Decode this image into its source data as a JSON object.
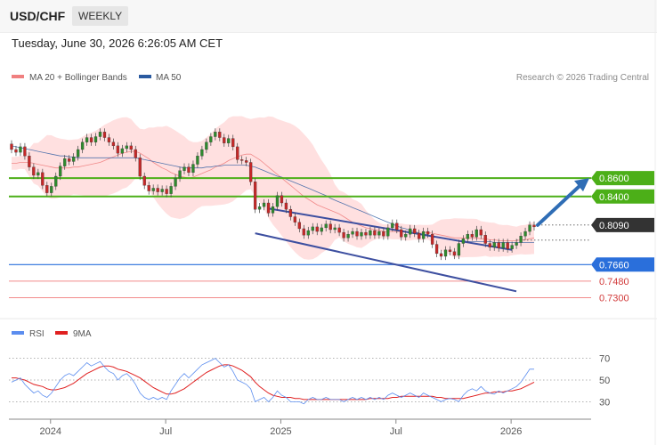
{
  "header": {
    "symbol": "USD/CHF",
    "period": "WEEKLY",
    "timestamp": "Tuesday, June 30, 2026 6:26:05 AM CET"
  },
  "legend": {
    "items": [
      {
        "label": "MA 20 + Bollinger Bands",
        "color": "#f08080"
      },
      {
        "label": "MA 50",
        "color": "#2a5aa0"
      }
    ],
    "credit": "Research © 2026 Trading Central"
  },
  "rsi_legend": {
    "items": [
      {
        "label": "RSI",
        "color": "#5b8def"
      },
      {
        "label": "9MA",
        "color": "#e02020"
      }
    ]
  },
  "colors": {
    "up_candle": "#2e8b2e",
    "down_candle": "#c62828",
    "bollinger_fill": "#ffd6d6",
    "resistance": "#4caf18",
    "support": "#2a6fdb",
    "lower_support": "#f28b8b",
    "arrow": "#2f6db5",
    "current_tag": "#333333",
    "channel": "#3d4fa0"
  },
  "chart_data": [
    {
      "type": "candlestick",
      "title": "",
      "ylim": [
        0.717,
        0.949
      ],
      "x_tick_labels": [
        "2024",
        "Jul",
        "2025",
        "Jul",
        "2026"
      ],
      "candles": [
        {
          "o": 0.897,
          "c": 0.891
        },
        {
          "o": 0.891,
          "c": 0.888
        },
        {
          "o": 0.888,
          "c": 0.894
        },
        {
          "o": 0.894,
          "c": 0.884
        },
        {
          "o": 0.884,
          "c": 0.872
        },
        {
          "o": 0.872,
          "c": 0.863
        },
        {
          "o": 0.863,
          "c": 0.866
        },
        {
          "o": 0.866,
          "c": 0.852
        },
        {
          "o": 0.852,
          "c": 0.844
        },
        {
          "o": 0.844,
          "c": 0.851
        },
        {
          "o": 0.851,
          "c": 0.862
        },
        {
          "o": 0.862,
          "c": 0.873
        },
        {
          "o": 0.873,
          "c": 0.881
        },
        {
          "o": 0.881,
          "c": 0.878
        },
        {
          "o": 0.878,
          "c": 0.883
        },
        {
          "o": 0.883,
          "c": 0.891
        },
        {
          "o": 0.891,
          "c": 0.899
        },
        {
          "o": 0.899,
          "c": 0.904
        },
        {
          "o": 0.904,
          "c": 0.899
        },
        {
          "o": 0.899,
          "c": 0.905
        },
        {
          "o": 0.905,
          "c": 0.91
        },
        {
          "o": 0.91,
          "c": 0.904
        },
        {
          "o": 0.904,
          "c": 0.899
        },
        {
          "o": 0.899,
          "c": 0.895
        },
        {
          "o": 0.895,
          "c": 0.887
        },
        {
          "o": 0.887,
          "c": 0.892
        },
        {
          "o": 0.892,
          "c": 0.895
        },
        {
          "o": 0.895,
          "c": 0.891
        },
        {
          "o": 0.891,
          "c": 0.882
        },
        {
          "o": 0.882,
          "c": 0.862
        },
        {
          "o": 0.862,
          "c": 0.852
        },
        {
          "o": 0.852,
          "c": 0.846
        },
        {
          "o": 0.846,
          "c": 0.849
        },
        {
          "o": 0.849,
          "c": 0.845
        },
        {
          "o": 0.845,
          "c": 0.848
        },
        {
          "o": 0.848,
          "c": 0.843
        },
        {
          "o": 0.843,
          "c": 0.851
        },
        {
          "o": 0.851,
          "c": 0.86
        },
        {
          "o": 0.86,
          "c": 0.868
        },
        {
          "o": 0.868,
          "c": 0.872
        },
        {
          "o": 0.872,
          "c": 0.866
        },
        {
          "o": 0.866,
          "c": 0.875
        },
        {
          "o": 0.875,
          "c": 0.884
        },
        {
          "o": 0.884,
          "c": 0.891
        },
        {
          "o": 0.891,
          "c": 0.899
        },
        {
          "o": 0.899,
          "c": 0.905
        },
        {
          "o": 0.905,
          "c": 0.91
        },
        {
          "o": 0.91,
          "c": 0.904
        },
        {
          "o": 0.904,
          "c": 0.898
        },
        {
          "o": 0.898,
          "c": 0.903
        },
        {
          "o": 0.903,
          "c": 0.894
        },
        {
          "o": 0.894,
          "c": 0.88
        },
        {
          "o": 0.88,
          "c": 0.879
        },
        {
          "o": 0.879,
          "c": 0.877
        },
        {
          "o": 0.877,
          "c": 0.856
        },
        {
          "o": 0.856,
          "c": 0.826
        },
        {
          "o": 0.826,
          "c": 0.829
        },
        {
          "o": 0.829,
          "c": 0.833
        },
        {
          "o": 0.833,
          "c": 0.822
        },
        {
          "o": 0.822,
          "c": 0.829
        },
        {
          "o": 0.829,
          "c": 0.841
        },
        {
          "o": 0.841,
          "c": 0.833
        },
        {
          "o": 0.833,
          "c": 0.826
        },
        {
          "o": 0.826,
          "c": 0.818
        },
        {
          "o": 0.818,
          "c": 0.812
        },
        {
          "o": 0.812,
          "c": 0.805
        },
        {
          "o": 0.805,
          "c": 0.798
        },
        {
          "o": 0.798,
          "c": 0.803
        },
        {
          "o": 0.803,
          "c": 0.807
        },
        {
          "o": 0.807,
          "c": 0.802
        },
        {
          "o": 0.802,
          "c": 0.806
        },
        {
          "o": 0.806,
          "c": 0.81
        },
        {
          "o": 0.81,
          "c": 0.804
        },
        {
          "o": 0.804,
          "c": 0.806
        },
        {
          "o": 0.806,
          "c": 0.801
        },
        {
          "o": 0.801,
          "c": 0.795
        },
        {
          "o": 0.795,
          "c": 0.799
        },
        {
          "o": 0.799,
          "c": 0.802
        },
        {
          "o": 0.802,
          "c": 0.797
        },
        {
          "o": 0.797,
          "c": 0.801
        },
        {
          "o": 0.801,
          "c": 0.798
        },
        {
          "o": 0.798,
          "c": 0.803
        },
        {
          "o": 0.803,
          "c": 0.798
        },
        {
          "o": 0.798,
          "c": 0.802
        },
        {
          "o": 0.802,
          "c": 0.797
        },
        {
          "o": 0.797,
          "c": 0.806
        },
        {
          "o": 0.806,
          "c": 0.811
        },
        {
          "o": 0.811,
          "c": 0.804
        },
        {
          "o": 0.804,
          "c": 0.796
        },
        {
          "o": 0.796,
          "c": 0.799
        },
        {
          "o": 0.799,
          "c": 0.805
        },
        {
          "o": 0.805,
          "c": 0.8
        },
        {
          "o": 0.8,
          "c": 0.794
        },
        {
          "o": 0.794,
          "c": 0.802
        },
        {
          "o": 0.802,
          "c": 0.799
        },
        {
          "o": 0.799,
          "c": 0.788
        },
        {
          "o": 0.788,
          "c": 0.778
        },
        {
          "o": 0.778,
          "c": 0.775
        },
        {
          "o": 0.775,
          "c": 0.782
        },
        {
          "o": 0.782,
          "c": 0.78
        },
        {
          "o": 0.78,
          "c": 0.776
        },
        {
          "o": 0.776,
          "c": 0.789
        },
        {
          "o": 0.789,
          "c": 0.794
        },
        {
          "o": 0.794,
          "c": 0.799
        },
        {
          "o": 0.799,
          "c": 0.796
        },
        {
          "o": 0.796,
          "c": 0.804
        },
        {
          "o": 0.804,
          "c": 0.798
        },
        {
          "o": 0.798,
          "c": 0.789
        },
        {
          "o": 0.789,
          "c": 0.785
        },
        {
          "o": 0.785,
          "c": 0.79
        },
        {
          "o": 0.79,
          "c": 0.784
        },
        {
          "o": 0.784,
          "c": 0.79
        },
        {
          "o": 0.79,
          "c": 0.783
        },
        {
          "o": 0.783,
          "c": 0.787
        },
        {
          "o": 0.787,
          "c": 0.79
        },
        {
          "o": 0.79,
          "c": 0.797
        },
        {
          "o": 0.797,
          "c": 0.802
        },
        {
          "o": 0.802,
          "c": 0.809
        },
        {
          "o": 0.809,
          "c": 0.807
        }
      ],
      "lines": [
        {
          "name": "MA 20 + Bollinger Bands",
          "color": "#f08080",
          "values": [
            0.876,
            0.876,
            0.877,
            0.877,
            0.877,
            0.876,
            0.875,
            0.874,
            0.873,
            0.872,
            0.871,
            0.871,
            0.871,
            0.871,
            0.872,
            0.872,
            0.873,
            0.874,
            0.875,
            0.876,
            0.877,
            0.879,
            0.881,
            0.883,
            0.885,
            0.887,
            0.888,
            0.889,
            0.889,
            0.887,
            0.884,
            0.881,
            0.877,
            0.874,
            0.871,
            0.869,
            0.866,
            0.864,
            0.862,
            0.861,
            0.86,
            0.861,
            0.863,
            0.865,
            0.867,
            0.869,
            0.872,
            0.874,
            0.876,
            0.879,
            0.881,
            0.883,
            0.885,
            0.886,
            0.886,
            0.883,
            0.88,
            0.876,
            0.872,
            0.868,
            0.864,
            0.86,
            0.856,
            0.852,
            0.848,
            0.844,
            0.84,
            0.837,
            0.834,
            0.831,
            0.829,
            0.827,
            0.825,
            0.823,
            0.821,
            0.818,
            0.815,
            0.812,
            0.81,
            0.808,
            0.806,
            0.805,
            0.804,
            0.803,
            0.802,
            0.802,
            0.802,
            0.802,
            0.802,
            0.801,
            0.801,
            0.801,
            0.801,
            0.801,
            0.801,
            0.8,
            0.799,
            0.798,
            0.797,
            0.796,
            0.795,
            0.795,
            0.795,
            0.795,
            0.795,
            0.795,
            0.794,
            0.794,
            0.793,
            0.793,
            0.792,
            0.792,
            0.792,
            0.792,
            0.792,
            0.793,
            0.793,
            0.794,
            0.795
          ]
        },
        {
          "name": "MA 50",
          "color": "#2a5aa0",
          "values": [
            0.895,
            0.894,
            0.893,
            0.892,
            0.891,
            0.89,
            0.889,
            0.888,
            0.887,
            0.886,
            0.885,
            0.884,
            0.884,
            0.883,
            0.883,
            0.882,
            0.882,
            0.882,
            0.882,
            0.882,
            0.882,
            0.882,
            0.882,
            0.882,
            0.882,
            0.882,
            0.882,
            0.882,
            0.882,
            0.881,
            0.88,
            0.879,
            0.878,
            0.877,
            0.876,
            0.875,
            0.874,
            0.873,
            0.872,
            0.871,
            0.871,
            0.871,
            0.871,
            0.871,
            0.872,
            0.872,
            0.873,
            0.873,
            0.874,
            0.874,
            0.874,
            0.874,
            0.874,
            0.874,
            0.873,
            0.872,
            0.87,
            0.868,
            0.866,
            0.864,
            0.862,
            0.861,
            0.859,
            0.857,
            0.855,
            0.853,
            0.851,
            0.849,
            0.847,
            0.845,
            0.843,
            0.841,
            0.838,
            0.836,
            0.834,
            0.832,
            0.83,
            0.828,
            0.826,
            0.824,
            0.822,
            0.82,
            0.818,
            0.816,
            0.814,
            0.812,
            0.81,
            0.808,
            0.806,
            0.805,
            0.803,
            0.802,
            0.8,
            0.799,
            0.798,
            0.797,
            0.796,
            0.795,
            0.794,
            0.793,
            0.793,
            0.792,
            0.792,
            0.791,
            0.791,
            0.791,
            0.791,
            0.791,
            0.791,
            0.79,
            0.79,
            0.79,
            0.79,
            0.79,
            0.79,
            0.79,
            0.79,
            0.79,
            0.79
          ]
        }
      ],
      "levels": [
        {
          "label": "0.8600",
          "value": 0.86,
          "role": "resistance"
        },
        {
          "label": "0.8400",
          "value": 0.84,
          "role": "resistance"
        },
        {
          "label": "0.8090",
          "value": 0.809,
          "role": "current"
        },
        {
          "label": "0.7660",
          "value": 0.766,
          "role": "support"
        },
        {
          "label": "0.7480",
          "value": 0.748,
          "role": "lower_support"
        },
        {
          "label": "0.7300",
          "value": 0.73,
          "role": "lower_support"
        }
      ]
    },
    {
      "type": "line",
      "title": "",
      "ylim": [
        18,
        82
      ],
      "y_ticks": [
        70,
        50,
        30
      ],
      "series": [
        {
          "name": "RSI",
          "color": "#5b8def",
          "values": [
            48,
            50,
            52,
            46,
            42,
            38,
            40,
            36,
            34,
            38,
            44,
            50,
            54,
            56,
            54,
            58,
            62,
            66,
            63,
            65,
            67,
            62,
            58,
            56,
            50,
            54,
            56,
            52,
            46,
            38,
            34,
            32,
            34,
            32,
            34,
            32,
            40,
            46,
            52,
            56,
            52,
            56,
            60,
            64,
            66,
            68,
            70,
            66,
            62,
            64,
            58,
            50,
            48,
            46,
            42,
            30,
            32,
            34,
            30,
            34,
            40,
            36,
            34,
            30,
            30,
            30,
            28,
            32,
            34,
            32,
            32,
            34,
            32,
            32,
            32,
            30,
            32,
            34,
            32,
            34,
            32,
            34,
            32,
            34,
            32,
            36,
            38,
            36,
            34,
            36,
            38,
            36,
            34,
            38,
            36,
            34,
            32,
            30,
            32,
            33,
            32,
            30,
            36,
            40,
            42,
            40,
            44,
            40,
            38,
            37,
            40,
            38,
            40,
            42,
            44,
            48,
            54,
            60,
            60
          ]
        },
        {
          "name": "9MA",
          "color": "#e02020",
          "values": [
            52,
            52,
            51,
            50,
            48,
            46,
            45,
            44,
            42,
            41,
            41,
            42,
            43,
            45,
            47,
            50,
            53,
            56,
            58,
            60,
            62,
            63,
            63,
            62,
            60,
            59,
            58,
            56,
            54,
            52,
            49,
            46,
            43,
            41,
            39,
            37,
            37,
            38,
            40,
            42,
            45,
            48,
            51,
            54,
            57,
            59,
            61,
            63,
            64,
            64,
            63,
            61,
            59,
            56,
            53,
            48,
            44,
            41,
            38,
            36,
            35,
            34,
            34,
            34,
            33,
            33,
            32,
            32,
            32,
            32,
            32,
            32,
            32,
            32,
            32,
            32,
            32,
            32,
            32,
            32,
            32,
            33,
            33,
            33,
            33,
            33,
            34,
            34,
            35,
            35,
            35,
            35,
            35,
            35,
            35,
            35,
            34,
            34,
            33,
            33,
            33,
            33,
            33,
            34,
            35,
            36,
            37,
            38,
            38,
            39,
            39,
            39,
            40,
            40,
            41,
            42,
            44,
            46,
            48
          ]
        }
      ]
    }
  ]
}
